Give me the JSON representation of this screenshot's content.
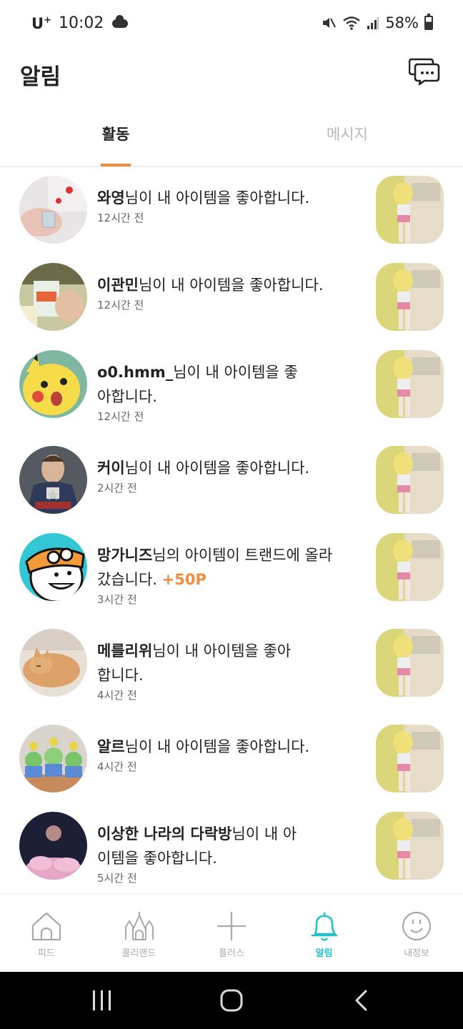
{
  "status_bar": {
    "carrier": "U",
    "carrier_plus": "+",
    "time": "10:02",
    "battery": "58%"
  },
  "header": {
    "title": "알림"
  },
  "tabs": [
    {
      "label": "활동",
      "active": true
    },
    {
      "label": "메시지",
      "active": false
    }
  ],
  "notifications": [
    {
      "user": "와영",
      "text": "님이 내 아이템을 좋아합니다.",
      "points": "",
      "time": "12시간 전"
    },
    {
      "user": "이관민",
      "text": "님이 내 아이템을 좋아합니다.",
      "points": "",
      "time": "12시간 전"
    },
    {
      "user": "o0.hmm_",
      "text": "님이 내 아이템을 좋아합니다.",
      "points": "",
      "time": "12시간 전"
    },
    {
      "user": "커이",
      "text": "님이 내 아이템을 좋아합니다.",
      "points": "",
      "time": "2시간 전"
    },
    {
      "user": "망가니즈",
      "text": "님의 아이템이 트랜드에 올라갔습니다.",
      "points": "+50P",
      "time": "3시간 전"
    },
    {
      "user": "메를리위",
      "text": "님이 내 아이템을 좋아합니다.",
      "points": "",
      "time": "4시간 전"
    },
    {
      "user": "알르",
      "text": "님이 내 아이템을 좋아합니다.",
      "points": "",
      "time": "4시간 전"
    },
    {
      "user": "이상한 나라의 다락방",
      "text": "님이 내 아이템을 좋아합니다.",
      "points": "",
      "time": "5시간 전"
    }
  ],
  "bottom_nav": [
    {
      "label": "피드",
      "icon": "home-icon",
      "active": false
    },
    {
      "label": "콜리랜드",
      "icon": "castle-icon",
      "active": false
    },
    {
      "label": "플러스",
      "icon": "plus-icon",
      "active": false
    },
    {
      "label": "알림",
      "icon": "bell-icon",
      "active": true
    },
    {
      "label": "내정보",
      "icon": "smiley-icon",
      "active": false
    }
  ],
  "colors": {
    "accent_orange": "#f08c3a",
    "accent_teal": "#22c2c6",
    "inactive_gray": "#a9a9a9"
  }
}
